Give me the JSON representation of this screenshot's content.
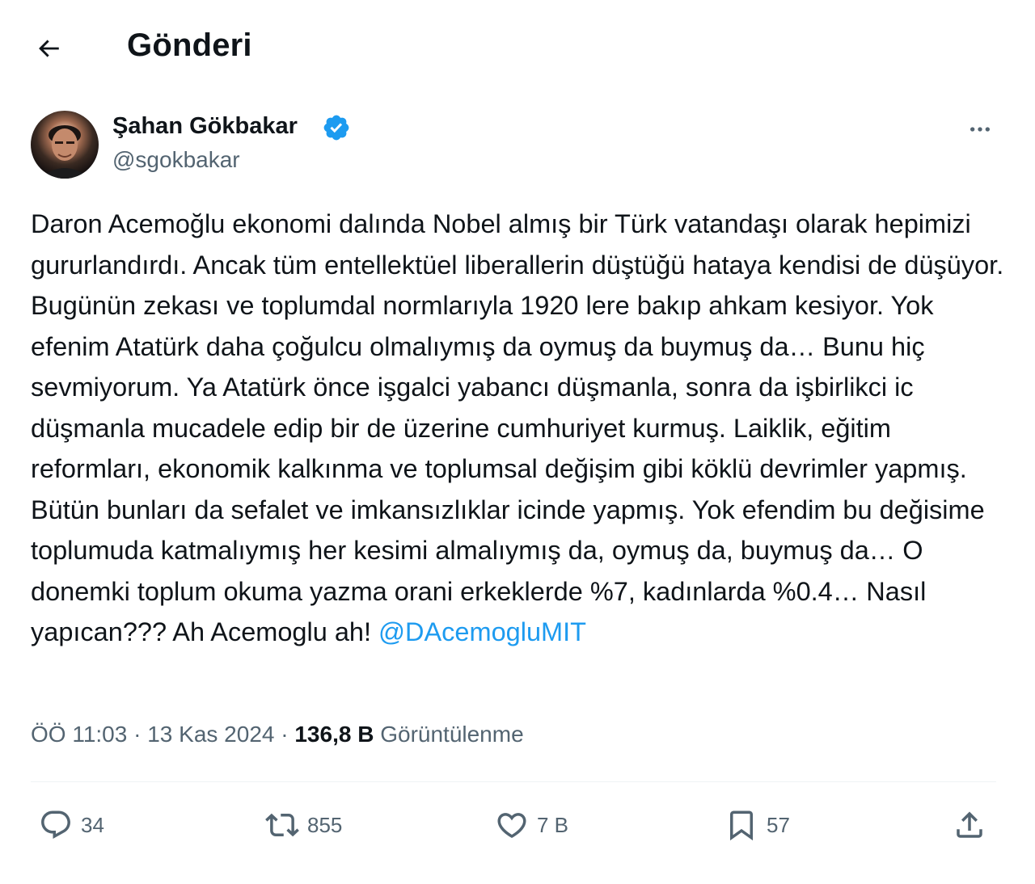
{
  "header": {
    "title": "Gönderi",
    "back_icon": "arrow-left-icon"
  },
  "tweet": {
    "author_name": "Şahan Gökbakar",
    "handle": "@sgokbakar",
    "text": "Daron Acemoğlu ekonomi dalında Nobel almış bir Türk vatandaşı olarak hepimizi gururlandırdı. Ancak tüm entellektüel liberallerin düştüğü hataya kendisi de düşüyor. Bugünün zekası ve toplumdal normlarıyla 1920 lere bakıp ahkam kesiyor. Yok efenim Atatürk daha çoğulcu olmalıymış da oymuş da buymuş da… Bunu hiç sevmiyorum. Ya Atatürk önce işgalci yabancı düşmanla, sonra da işbirlikci ic düşmanla mucadele edip bir de üzerine cumhuriyet kurmuş. Laiklik, eğitim reformları, ekonomik kalkınma ve toplumsal değişim gibi köklü devrimler yapmış. Bütün bunları da sefalet ve imkansızlıklar icinde yapmış. Yok efendim bu değisime toplumuda katmalıymış her kesimi almalıymış da, oymuş da, buymuş da… O donemki toplum okuma yazma orani erkeklerde %7, kadınlarda  %0.4… Nasıl yapıcan??? Ah Acemoglu ah! ",
    "mention": "@DAcemogluMIT",
    "time": "ÖÖ 11:03",
    "separator": "·",
    "date": "13 Kas 2024",
    "views_count": "136,8 B",
    "views_label": "Görüntülenme"
  },
  "actions": {
    "replies": "34",
    "reposts": "855",
    "likes": "7 B",
    "bookmarks": "57"
  },
  "colors": {
    "text": "#0f1419",
    "secondary": "#536471",
    "link": "#1d9bf0",
    "verified": "#1d9bf0"
  }
}
